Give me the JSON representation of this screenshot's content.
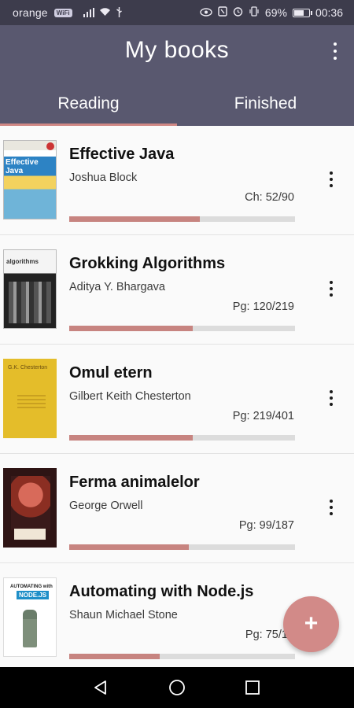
{
  "status_bar": {
    "carrier": "orange",
    "wifi_badge": "WiFi",
    "battery": "69%",
    "time": "00:36"
  },
  "app_bar": {
    "title": "My books"
  },
  "tabs": [
    {
      "label": "Reading",
      "active": true
    },
    {
      "label": "Finished",
      "active": false
    }
  ],
  "books": [
    {
      "title": "Effective Java",
      "author": "Joshua Block",
      "progress_text": "Ch: 52/90",
      "progress": 0.578
    },
    {
      "title": "Grokking Algorithms",
      "author": "Aditya Y. Bhargava",
      "progress_text": "Pg: 120/219",
      "progress": 0.548
    },
    {
      "title": "Omul etern",
      "author": "Gilbert Keith Chesterton",
      "progress_text": "Pg: 219/401",
      "progress": 0.546
    },
    {
      "title": "Ferma animalelor",
      "author": "George Orwell",
      "progress_text": "Pg: 99/187",
      "progress": 0.529
    },
    {
      "title": "Automating with Node.js",
      "author": "Shaun Michael Stone",
      "progress_text": "Pg: 75/18",
      "progress": 0.4
    }
  ],
  "covers": {
    "java": "Effective Java",
    "algo": "algorithms",
    "omul": "G.K. Chesterton",
    "node_top": "AUTOMATING with",
    "node_brand": "NODE.JS"
  },
  "fab": {
    "label": "+"
  },
  "colors": {
    "status_bar": "#3d3c4c",
    "app_bar": "#59586f",
    "accent": "#c78480",
    "fab": "#d28a88"
  }
}
